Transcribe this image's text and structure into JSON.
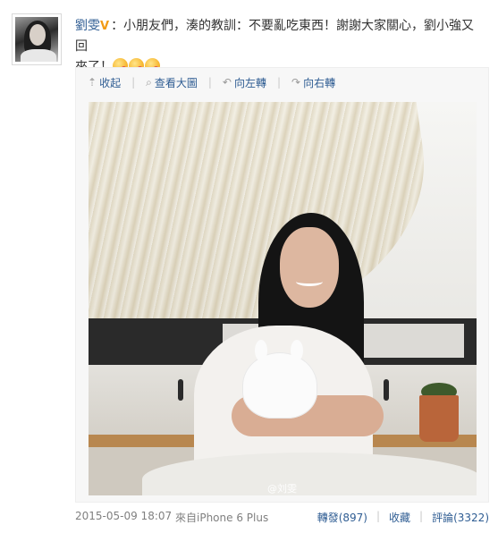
{
  "post": {
    "author": "劉雯",
    "badge": "V",
    "text_line1": "：小朋友們，湊的教訓：不要亂吃東西！謝謝大家關心，劉小強又回",
    "text_line2": "來了！"
  },
  "toolbar": {
    "collapse": "收起",
    "view_large": "查看大圖",
    "rotate_left": "向左轉",
    "rotate_right": "向右轉"
  },
  "photo": {
    "watermark": "@刘雯"
  },
  "footer": {
    "timestamp": "2015-05-09 18:07",
    "source": "來自iPhone 6 Plus",
    "repost": "轉發(897)",
    "favorite": "收藏",
    "comment": "評論(3322)"
  },
  "colors": {
    "link": "#2f5d93",
    "meta_text": "#808080",
    "badge": "#f29b16"
  }
}
